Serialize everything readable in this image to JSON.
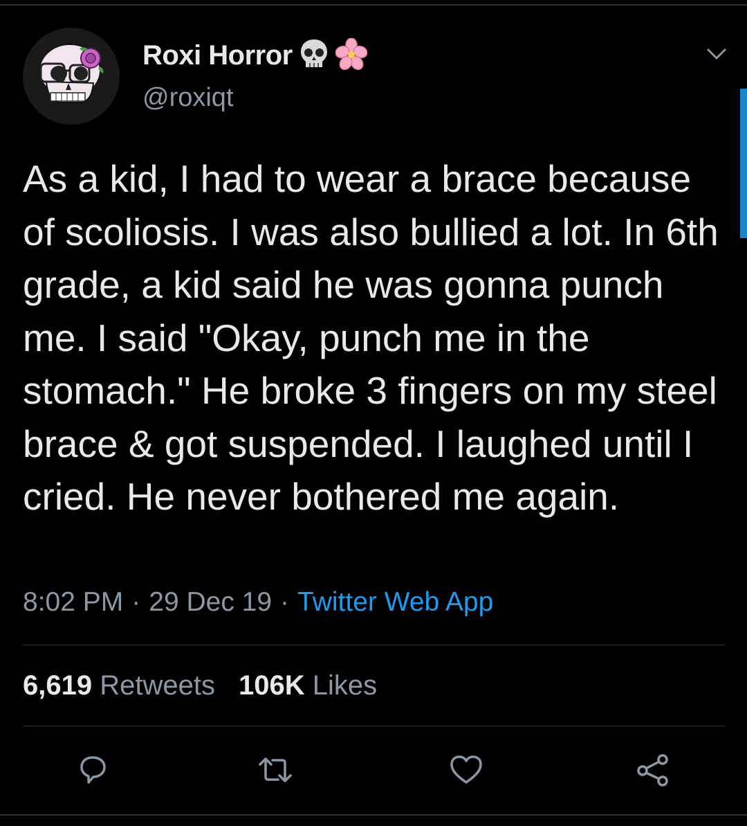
{
  "author": {
    "display_name": "Roxi Horror",
    "handle": "@roxiqt",
    "name_emojis": [
      "skull-icon",
      "cherry-blossom-icon"
    ]
  },
  "tweet": {
    "text": "As a kid, I had to wear a brace because of scoliosis. I was also bullied a lot. In 6th grade, a kid said he was gonna punch me. I said \"Okay, punch me in the stomach.\" He broke 3 fingers on my steel brace & got suspended. I laughed until I cried. He never bothered me again.",
    "time": "8:02 PM",
    "date": "29 Dec 19",
    "separator": "·",
    "source": "Twitter Web App"
  },
  "stats": {
    "retweets_count": "6,619",
    "retweets_label": "Retweets",
    "likes_count": "106K",
    "likes_label": "Likes"
  },
  "actions": [
    "reply-icon",
    "retweet-icon",
    "like-icon",
    "share-icon"
  ],
  "colors": {
    "background": "#000000",
    "text": "#e7e9ea",
    "secondary": "#8b98a5",
    "accent": "#1d9bf0",
    "divider": "#2f3336"
  }
}
